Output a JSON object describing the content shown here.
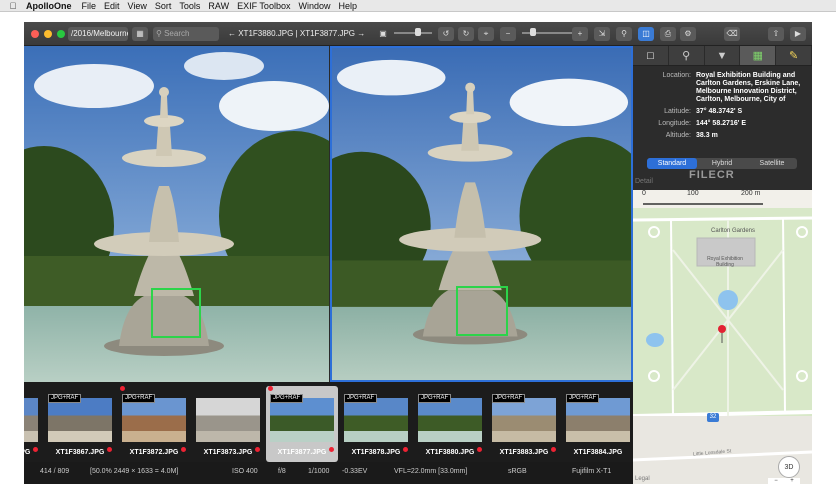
{
  "menubar": {
    "app": "ApolloOne",
    "items": [
      "File",
      "Edit",
      "View",
      "Sort",
      "Tools",
      "RAW",
      "EXIF Toolbox",
      "Window",
      "Help"
    ]
  },
  "toolbar": {
    "path": "/2016/Melbourne",
    "search_placeholder": "Search",
    "title": "← XT1F3880.JPG | XT1F3877.JPG →"
  },
  "inspector": {
    "tabs": [
      "document-icon",
      "search-icon",
      "filter-icon",
      "map-icon",
      "notes-icon"
    ],
    "location_label": "Location:",
    "location_value": "Royal Exhibition Building and Carlton Gardens, Erskine Lane, Melbourne Innovation District, Carlton, Melbourne, City of",
    "latitude_label": "Latitude:",
    "latitude_value": "37° 48.3742' S",
    "longitude_label": "Longitude:",
    "longitude_value": "144° 58.2716' E",
    "altitude_label": "Altitude:",
    "altitude_value": "38.3 m",
    "map_modes": [
      "Standard",
      "Hybrid",
      "Satellite"
    ],
    "active_mode": "Standard",
    "faded_tab": "Detail",
    "watermark": "FILECR",
    "scale": {
      "zero": "0",
      "mid": "100",
      "end": "200 m"
    },
    "map_labels": {
      "gardens": "Carlton Gardens",
      "building": "Royal Exhibition Building",
      "route": "32",
      "btn_3d": "3D",
      "minus": "−",
      "plus": "+",
      "legal": "Legal",
      "street": "Little Lonsdale St"
    }
  },
  "filmstrip": {
    "items": [
      {
        "name": "XT1F3866.JPG",
        "badge": "",
        "pin": true,
        "selected": false,
        "reddot": false
      },
      {
        "name": "XT1F3867.JPG",
        "badge": "JPG+RAF",
        "pin": true,
        "selected": false,
        "reddot": false
      },
      {
        "name": "XT1F3872.JPG",
        "badge": "JPG+RAF",
        "pin": true,
        "selected": false,
        "reddot": true
      },
      {
        "name": "XT1F3873.JPG",
        "badge": "",
        "pin": true,
        "selected": false,
        "reddot": false
      },
      {
        "name": "XT1F3877.JPG",
        "badge": "JPG+RAF",
        "pin": true,
        "selected": true,
        "reddot": true
      },
      {
        "name": "XT1F3878.JPG",
        "badge": "JPG+RAF",
        "pin": true,
        "selected": false,
        "reddot": false
      },
      {
        "name": "XT1F3880.JPG",
        "badge": "JPG+RAF",
        "pin": true,
        "selected": false,
        "reddot": false
      },
      {
        "name": "XT1F3883.JPG",
        "badge": "JPG+RAF",
        "pin": true,
        "selected": false,
        "reddot": false
      },
      {
        "name": "XT1F3884.JPG",
        "badge": "JPG+RAF",
        "pin": false,
        "selected": false,
        "reddot": false
      }
    ]
  },
  "statusbar": {
    "count": "414 / 809",
    "dims": "[50.0% 2449 × 1633 = 4.0M]",
    "iso": "ISO 400",
    "aperture": "f/8",
    "shutter": "1/1000",
    "ev": "-0.33EV",
    "focal": "VFL=22.0mm [33.0mm]",
    "colorspace": "sRGB",
    "camera": "Fujifilm X-T1"
  },
  "colors": {
    "accent": "#2d6fd8",
    "focus": "#2cd44a",
    "pin": "#e22233"
  }
}
